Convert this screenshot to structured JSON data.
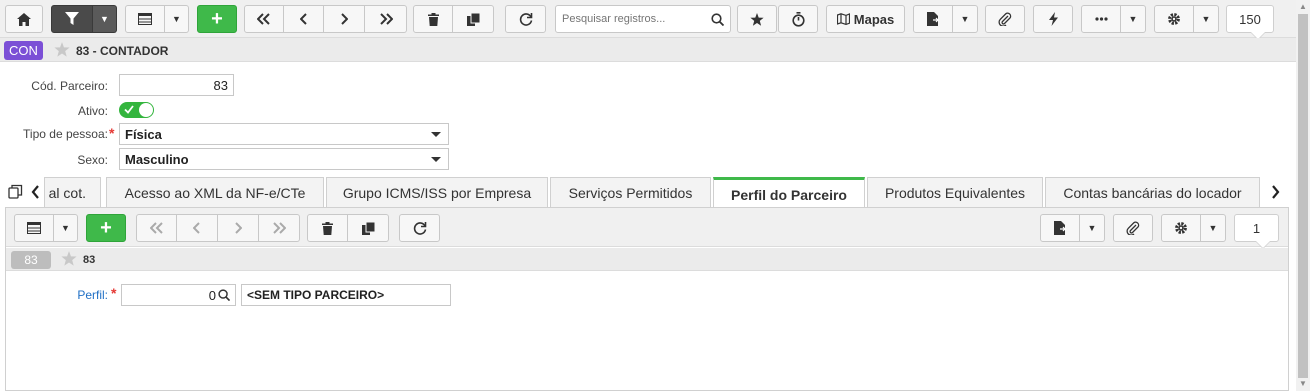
{
  "toolbar": {
    "home": "home-icon",
    "filter": "filter-icon",
    "grid": "grid-icon",
    "add": "+",
    "search_placeholder": "Pesquisar registros...",
    "maps_label": "Mapas",
    "record_count": "150"
  },
  "record": {
    "badge": "CON",
    "title": "83 - CONTADOR"
  },
  "form": {
    "cod_parceiro": {
      "label": "Cód. Parceiro:",
      "value": "83"
    },
    "ativo": {
      "label": "Ativo:",
      "on": true
    },
    "tipo_pessoa": {
      "label": "Tipo de pessoa:",
      "value": "Física",
      "required": "*"
    },
    "sexo": {
      "label": "Sexo:",
      "value": "Masculino"
    }
  },
  "tabs": [
    {
      "label": "al cot."
    },
    {
      "label": "Acesso ao XML da NF-e/CTe"
    },
    {
      "label": "Grupo ICMS/ISS por Empresa"
    },
    {
      "label": "Serviços Permitidos"
    },
    {
      "label": "Perfil do Parceiro",
      "active": true
    },
    {
      "label": "Produtos Equivalentes"
    },
    {
      "label": "Contas bancárias do locador"
    }
  ],
  "inner": {
    "record_count": "1",
    "badge": "83",
    "title": "83",
    "perfil": {
      "label": "Perfil:",
      "required": "*",
      "code": "0",
      "description": "<SEM TIPO PARCEIRO>"
    }
  },
  "colors": {
    "accent_green": "#3fb94a",
    "badge_purple": "#7b4fd6",
    "required_red": "#e53935",
    "link_blue": "#1f6fc5"
  }
}
